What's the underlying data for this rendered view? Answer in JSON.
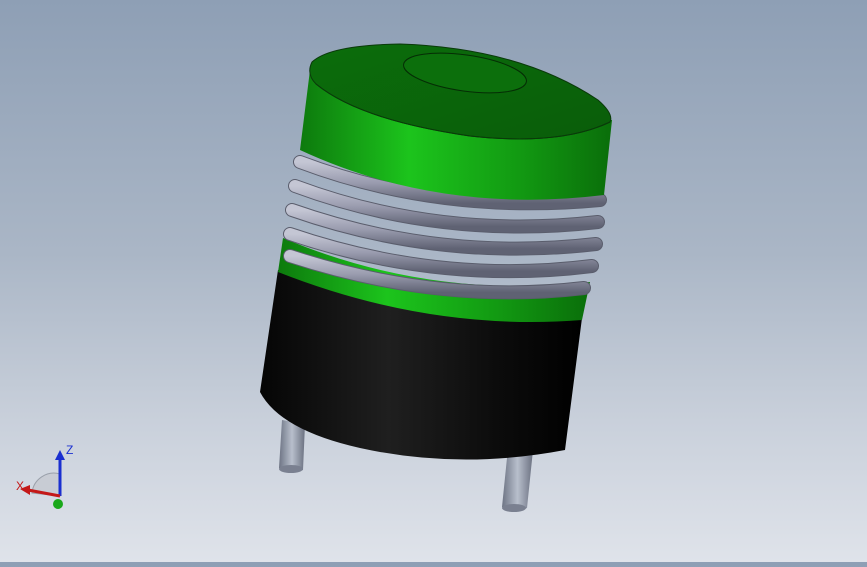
{
  "viewport": {
    "part": "coil-inductor",
    "background_top": "#8e9fb5",
    "background_bottom": "#dfe3ea"
  },
  "colors": {
    "body_green": "#129a12",
    "body_green_dark": "#0a6e0a",
    "base_black": "#0a0a0a",
    "winding_gray": "#9a9caf",
    "pin_gray": "#8e96a6"
  },
  "triad": {
    "x_label": "X",
    "z_label": "Z",
    "x_color": "#c41818",
    "z_color": "#1a2fd0",
    "y_color": "#1aa81a"
  }
}
